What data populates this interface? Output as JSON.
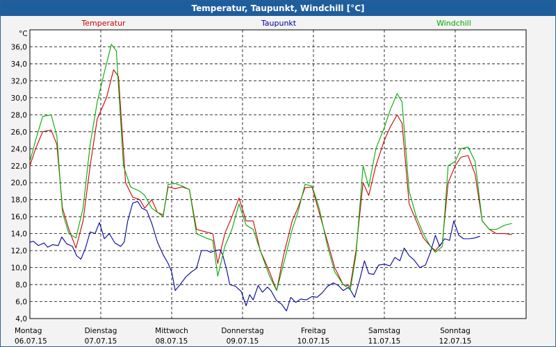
{
  "window": {
    "title": "Temperatur, Taupunkt, Windchill [°C]"
  },
  "chart_data": {
    "type": "line",
    "title": "Temperatur, Taupunkt, Windchill [°C]",
    "ylabel": "°C",
    "ylim": [
      4,
      38
    ],
    "yticks": [
      "4,0",
      "6,0",
      "8,0",
      "10,0",
      "12,0",
      "14,0",
      "16,0",
      "18,0",
      "20,0",
      "22,0",
      "24,0",
      "26,0",
      "28,0",
      "30,0",
      "32,0",
      "34,0",
      "36,0"
    ],
    "xlim": [
      0,
      7
    ],
    "grid": true,
    "x_categories": [
      {
        "day": "Montag",
        "date": "06.07.15"
      },
      {
        "day": "Dienstag",
        "date": "07.07.15"
      },
      {
        "day": "Mittwoch",
        "date": "08.07.15"
      },
      {
        "day": "Donnerstag",
        "date": "09.07.15"
      },
      {
        "day": "Freitag",
        "date": "10.07.15"
      },
      {
        "day": "Samstag",
        "date": "11.07.15"
      },
      {
        "day": "Sonntag",
        "date": "12.07.15"
      }
    ],
    "series": [
      {
        "name": "Temperatur",
        "color": "#cc0000",
        "points": [
          [
            0.0,
            22.0
          ],
          [
            0.08,
            24.0
          ],
          [
            0.18,
            26.0
          ],
          [
            0.3,
            26.2
          ],
          [
            0.38,
            24.5
          ],
          [
            0.46,
            17.0
          ],
          [
            0.55,
            14.5
          ],
          [
            0.65,
            12.3
          ],
          [
            0.75,
            15.5
          ],
          [
            0.85,
            22.0
          ],
          [
            0.95,
            27.5
          ],
          [
            1.08,
            30.0
          ],
          [
            1.18,
            33.3
          ],
          [
            1.25,
            32.5
          ],
          [
            1.35,
            20.0
          ],
          [
            1.45,
            18.3
          ],
          [
            1.55,
            18.0
          ],
          [
            1.62,
            17.0
          ],
          [
            1.72,
            18.0
          ],
          [
            1.8,
            16.5
          ],
          [
            1.88,
            16.2
          ],
          [
            1.95,
            19.5
          ],
          [
            2.05,
            19.3
          ],
          [
            2.15,
            19.5
          ],
          [
            2.25,
            19.2
          ],
          [
            2.35,
            14.5
          ],
          [
            2.48,
            14.2
          ],
          [
            2.58,
            14.0
          ],
          [
            2.65,
            10.5
          ],
          [
            2.75,
            14.0
          ],
          [
            2.85,
            16.0
          ],
          [
            2.95,
            18.2
          ],
          [
            3.05,
            15.5
          ],
          [
            3.15,
            15.5
          ],
          [
            3.25,
            12.0
          ],
          [
            3.38,
            9.5
          ],
          [
            3.48,
            7.3
          ],
          [
            3.58,
            11.5
          ],
          [
            3.7,
            15.5
          ],
          [
            3.78,
            17.0
          ],
          [
            3.88,
            19.4
          ],
          [
            3.98,
            19.5
          ],
          [
            4.08,
            16.5
          ],
          [
            4.2,
            13.0
          ],
          [
            4.3,
            10.0
          ],
          [
            4.42,
            8.0
          ],
          [
            4.52,
            7.8
          ],
          [
            4.6,
            12.0
          ],
          [
            4.7,
            20.0
          ],
          [
            4.78,
            18.5
          ],
          [
            4.88,
            22.0
          ],
          [
            5.0,
            25.0
          ],
          [
            5.08,
            26.5
          ],
          [
            5.18,
            28.0
          ],
          [
            5.25,
            27.0
          ],
          [
            5.35,
            17.5
          ],
          [
            5.45,
            15.5
          ],
          [
            5.55,
            13.5
          ],
          [
            5.65,
            12.5
          ],
          [
            5.72,
            12.0
          ],
          [
            5.82,
            13.0
          ],
          [
            5.9,
            20.0
          ],
          [
            6.0,
            22.0
          ],
          [
            6.08,
            23.0
          ],
          [
            6.18,
            23.2
          ],
          [
            6.28,
            21.0
          ],
          [
            6.38,
            15.5
          ],
          [
            6.48,
            14.5
          ],
          [
            6.58,
            14.0
          ],
          [
            6.7,
            14.0
          ],
          [
            6.8,
            13.9
          ]
        ]
      },
      {
        "name": "Taupunkt",
        "color": "#00009c",
        "points": [
          [
            0.0,
            13.0
          ],
          [
            0.05,
            13.1
          ],
          [
            0.12,
            12.6
          ],
          [
            0.2,
            12.9
          ],
          [
            0.25,
            12.4
          ],
          [
            0.32,
            12.7
          ],
          [
            0.4,
            12.6
          ],
          [
            0.45,
            13.6
          ],
          [
            0.52,
            12.8
          ],
          [
            0.6,
            12.5
          ],
          [
            0.66,
            11.4
          ],
          [
            0.72,
            11.0
          ],
          [
            0.78,
            12.2
          ],
          [
            0.85,
            14.2
          ],
          [
            0.92,
            14.0
          ],
          [
            0.98,
            15.3
          ],
          [
            1.05,
            13.4
          ],
          [
            1.12,
            14.0
          ],
          [
            1.2,
            12.9
          ],
          [
            1.28,
            12.5
          ],
          [
            1.33,
            13.0
          ],
          [
            1.38,
            15.5
          ],
          [
            1.45,
            17.6
          ],
          [
            1.52,
            17.8
          ],
          [
            1.58,
            17.0
          ],
          [
            1.65,
            16.7
          ],
          [
            1.72,
            15.2
          ],
          [
            1.8,
            13.0
          ],
          [
            1.88,
            11.5
          ],
          [
            1.95,
            10.5
          ],
          [
            2.0,
            9.5
          ],
          [
            2.05,
            7.3
          ],
          [
            2.12,
            8.0
          ],
          [
            2.2,
            8.9
          ],
          [
            2.28,
            9.5
          ],
          [
            2.35,
            9.9
          ],
          [
            2.42,
            12.0
          ],
          [
            2.5,
            12.0
          ],
          [
            2.55,
            11.8
          ],
          [
            2.62,
            12.0
          ],
          [
            2.68,
            12.1
          ],
          [
            2.72,
            11.5
          ],
          [
            2.78,
            9.6
          ],
          [
            2.82,
            8.0
          ],
          [
            2.9,
            7.8
          ],
          [
            2.98,
            7.2
          ],
          [
            3.05,
            5.5
          ],
          [
            3.1,
            6.8
          ],
          [
            3.15,
            6.2
          ],
          [
            3.22,
            7.9
          ],
          [
            3.28,
            7.1
          ],
          [
            3.35,
            7.7
          ],
          [
            3.4,
            7.3
          ],
          [
            3.48,
            6.1
          ],
          [
            3.55,
            5.7
          ],
          [
            3.62,
            4.9
          ],
          [
            3.68,
            6.5
          ],
          [
            3.75,
            5.9
          ],
          [
            3.82,
            6.3
          ],
          [
            3.9,
            6.2
          ],
          [
            3.98,
            6.6
          ],
          [
            4.05,
            6.5
          ],
          [
            4.12,
            7.0
          ],
          [
            4.2,
            7.8
          ],
          [
            4.28,
            8.2
          ],
          [
            4.35,
            7.9
          ],
          [
            4.42,
            7.3
          ],
          [
            4.5,
            7.7
          ],
          [
            4.58,
            6.5
          ],
          [
            4.65,
            8.5
          ],
          [
            4.72,
            10.8
          ],
          [
            4.78,
            9.3
          ],
          [
            4.85,
            9.2
          ],
          [
            4.92,
            10.3
          ],
          [
            5.0,
            10.4
          ],
          [
            5.08,
            10.2
          ],
          [
            5.15,
            11.2
          ],
          [
            5.22,
            10.8
          ],
          [
            5.28,
            12.3
          ],
          [
            5.35,
            11.4
          ],
          [
            5.42,
            10.9
          ],
          [
            5.5,
            10.0
          ],
          [
            5.58,
            10.3
          ],
          [
            5.65,
            11.8
          ],
          [
            5.72,
            13.8
          ],
          [
            5.78,
            12.5
          ],
          [
            5.85,
            13.4
          ],
          [
            5.92,
            13.2
          ],
          [
            5.98,
            15.5
          ],
          [
            6.05,
            13.8
          ],
          [
            6.12,
            13.4
          ],
          [
            6.2,
            13.4
          ],
          [
            6.28,
            13.5
          ],
          [
            6.35,
            13.7
          ]
        ]
      },
      {
        "name": "Windchill",
        "color": "#00aa00",
        "points": [
          [
            0.0,
            22.5
          ],
          [
            0.08,
            25.0
          ],
          [
            0.18,
            27.8
          ],
          [
            0.3,
            28.0
          ],
          [
            0.38,
            25.5
          ],
          [
            0.46,
            16.5
          ],
          [
            0.55,
            14.0
          ],
          [
            0.65,
            13.5
          ],
          [
            0.75,
            17.0
          ],
          [
            0.85,
            24.5
          ],
          [
            0.95,
            29.5
          ],
          [
            1.05,
            33.0
          ],
          [
            1.15,
            36.3
          ],
          [
            1.22,
            35.5
          ],
          [
            1.32,
            22.0
          ],
          [
            1.42,
            19.5
          ],
          [
            1.55,
            19.0
          ],
          [
            1.62,
            18.5
          ],
          [
            1.72,
            17.0
          ],
          [
            1.8,
            16.5
          ],
          [
            1.88,
            16.0
          ],
          [
            1.95,
            19.8
          ],
          [
            2.05,
            19.9
          ],
          [
            2.15,
            19.6
          ],
          [
            2.25,
            19.2
          ],
          [
            2.35,
            14.0
          ],
          [
            2.48,
            13.5
          ],
          [
            2.58,
            13.2
          ],
          [
            2.65,
            9.0
          ],
          [
            2.75,
            12.5
          ],
          [
            2.85,
            14.5
          ],
          [
            2.95,
            17.5
          ],
          [
            3.05,
            15.0
          ],
          [
            3.15,
            14.5
          ],
          [
            3.25,
            12.0
          ],
          [
            3.38,
            9.0
          ],
          [
            3.48,
            7.3
          ],
          [
            3.58,
            10.5
          ],
          [
            3.7,
            14.5
          ],
          [
            3.78,
            16.5
          ],
          [
            3.88,
            19.8
          ],
          [
            3.98,
            19.6
          ],
          [
            4.08,
            17.0
          ],
          [
            4.2,
            12.5
          ],
          [
            4.3,
            9.5
          ],
          [
            4.42,
            8.0
          ],
          [
            4.52,
            7.4
          ],
          [
            4.6,
            11.5
          ],
          [
            4.7,
            22.0
          ],
          [
            4.78,
            19.5
          ],
          [
            4.88,
            24.0
          ],
          [
            5.0,
            26.5
          ],
          [
            5.08,
            28.5
          ],
          [
            5.18,
            30.5
          ],
          [
            5.25,
            29.5
          ],
          [
            5.35,
            19.0
          ],
          [
            5.45,
            16.0
          ],
          [
            5.55,
            14.0
          ],
          [
            5.65,
            12.5
          ],
          [
            5.72,
            11.8
          ],
          [
            5.82,
            12.5
          ],
          [
            5.9,
            22.0
          ],
          [
            6.0,
            22.5
          ],
          [
            6.08,
            24.0
          ],
          [
            6.18,
            24.2
          ],
          [
            6.28,
            22.5
          ],
          [
            6.38,
            15.5
          ],
          [
            6.48,
            14.5
          ],
          [
            6.58,
            14.5
          ],
          [
            6.7,
            15.0
          ],
          [
            6.8,
            15.2
          ]
        ]
      }
    ]
  }
}
